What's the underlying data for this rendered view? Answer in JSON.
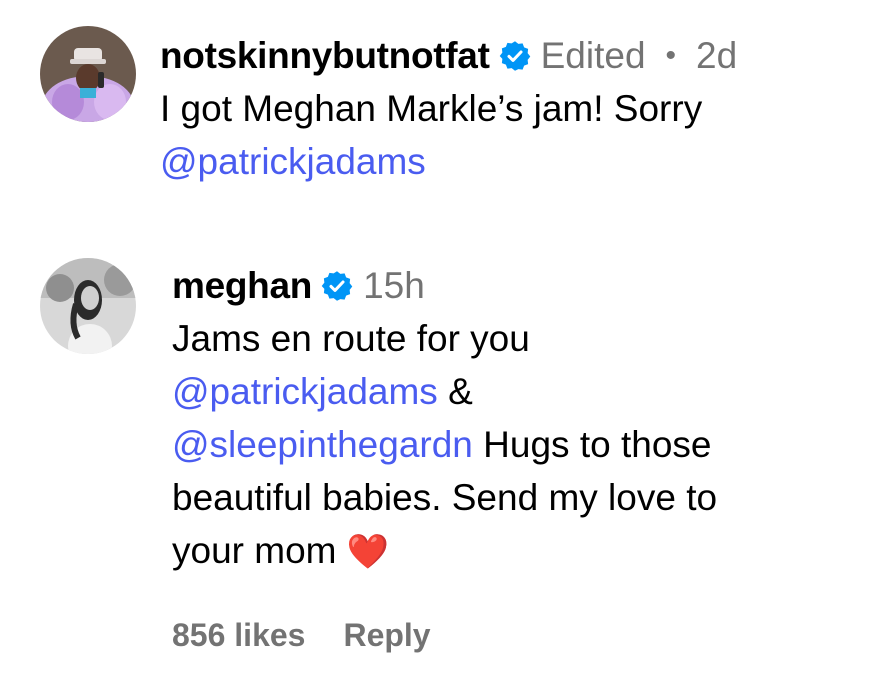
{
  "comments": [
    {
      "username": "notskinnybutnotfat",
      "verified": true,
      "edited": "Edited",
      "separator": "•",
      "age": "2d",
      "lines": [
        {
          "text": "I got Meghan Markle’s jam! Sorry"
        },
        {
          "mention": "@patrickjadams"
        }
      ]
    },
    {
      "username": "meghan",
      "verified": true,
      "age": "15h",
      "lines": [
        {
          "text": "Jams en route for you"
        },
        {
          "mention": "@patrickjadams",
          "text": " &"
        },
        {
          "mention": "@sleepinthegardn",
          "text": " Hugs to those"
        },
        {
          "text": "beautiful babies. Send my love to"
        },
        {
          "text": "your mom ",
          "emoji": "❤️"
        }
      ],
      "likes": "856 likes",
      "reply_label": "Reply"
    }
  ],
  "colors": {
    "verified_badge": "#0095f6",
    "mention": "#4a5cf0",
    "muted": "#737373"
  }
}
